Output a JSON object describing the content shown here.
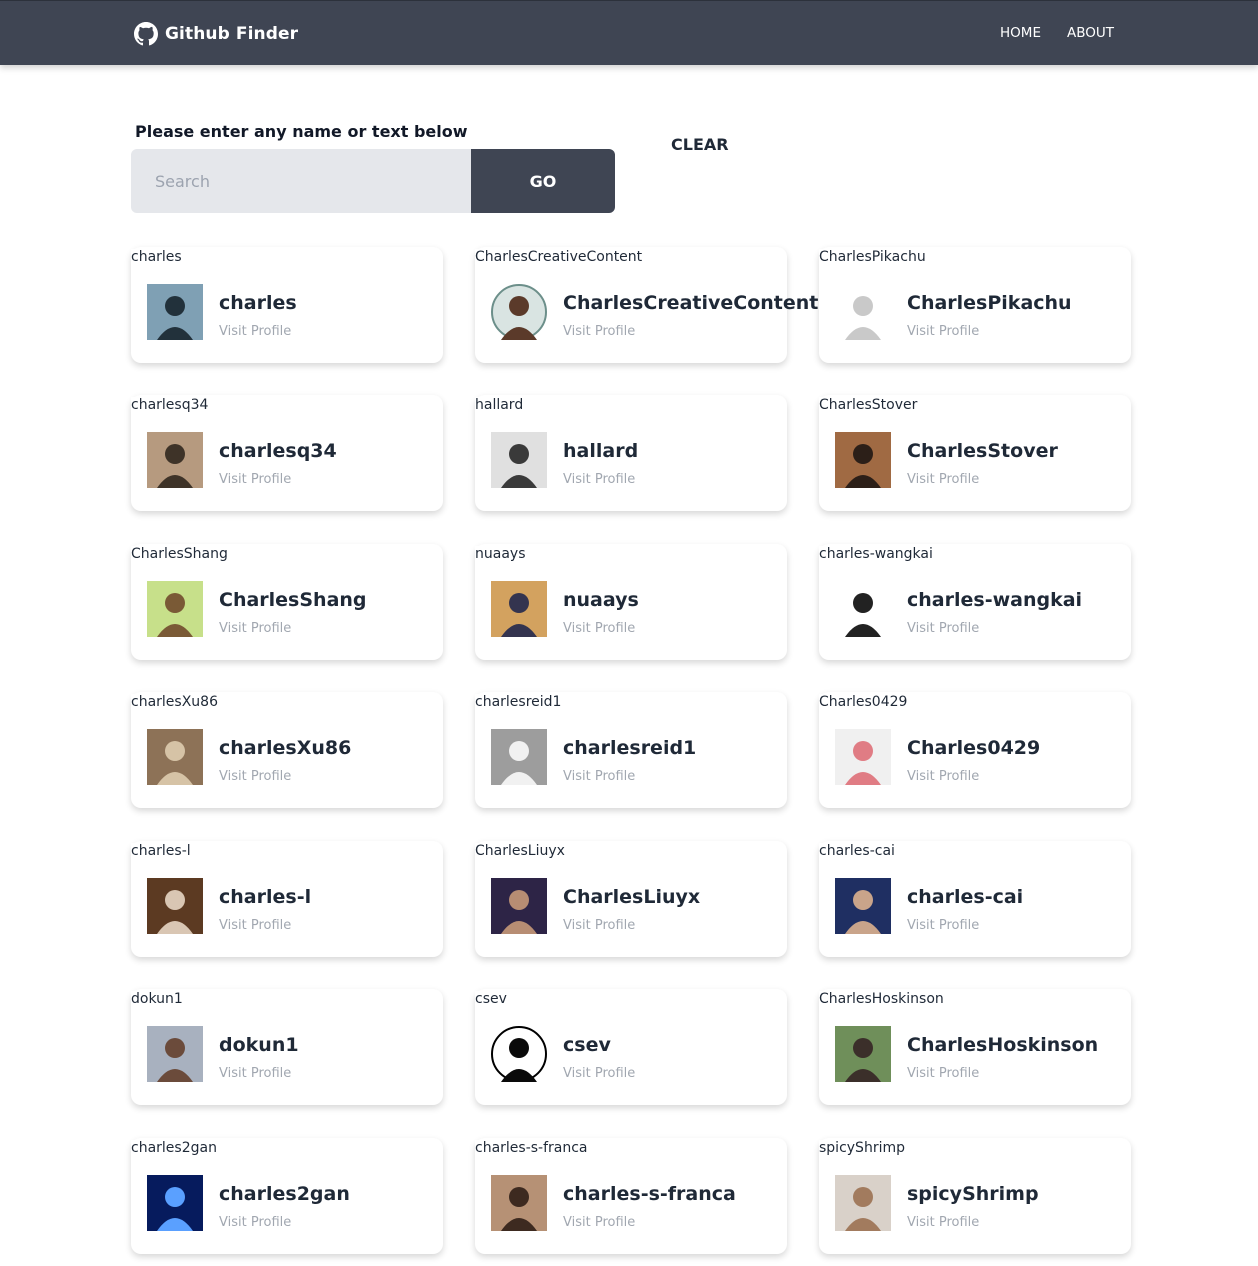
{
  "app": {
    "title": "Github Finder",
    "brand_icon": "github-icon"
  },
  "nav": {
    "home_label": "HOME",
    "about_label": "ABOUT"
  },
  "search": {
    "label": "Please enter any name or text below",
    "placeholder": "Search",
    "value": "",
    "go_label": "GO",
    "clear_label": "CLEAR"
  },
  "colors": {
    "navbar": "#3f4553",
    "go_button": "#3f4553",
    "input_bg": "#e5e7eb",
    "muted_text": "#a1a7b0"
  },
  "users": [
    {
      "login": "charles",
      "visit_label": "Visit Profile",
      "avatar": "silhouette-at-sunset"
    },
    {
      "login": "CharlesCreativeContent",
      "visit_label": "Visit Profile",
      "avatar": "smiling-man-circle"
    },
    {
      "login": "CharlesPikachu",
      "visit_label": "Visit Profile",
      "avatar": "line-sketch"
    },
    {
      "login": "charlesq34",
      "visit_label": "Visit Profile",
      "avatar": "man-with-glasses"
    },
    {
      "login": "hallard",
      "visit_label": "Visit Profile",
      "avatar": "bald-man-bw"
    },
    {
      "login": "CharlesStover",
      "visit_label": "Visit Profile",
      "avatar": "man-in-suit"
    },
    {
      "login": "CharlesShang",
      "visit_label": "Visit Profile",
      "avatar": "cartoon-character"
    },
    {
      "login": "nuaays",
      "visit_label": "Visit Profile",
      "avatar": "anime-warrior"
    },
    {
      "login": "charles-wangkai",
      "visit_label": "Visit Profile",
      "avatar": "white-robot-cartoon"
    },
    {
      "login": "charlesXu86",
      "visit_label": "Visit Profile",
      "avatar": "monkey-photo"
    },
    {
      "login": "charlesreid1",
      "visit_label": "Visit Profile",
      "avatar": "astronaut-bw"
    },
    {
      "login": "Charles0429",
      "visit_label": "Visit Profile",
      "avatar": "pink-identicon"
    },
    {
      "login": "charles-l",
      "visit_label": "Visit Profile",
      "avatar": "painted-face"
    },
    {
      "login": "CharlesLiuyx",
      "visit_label": "Visit Profile",
      "avatar": "young-man-night"
    },
    {
      "login": "charles-cai",
      "visit_label": "Visit Profile",
      "avatar": "man-with-glasses-blue"
    },
    {
      "login": "dokun1",
      "visit_label": "Visit Profile",
      "avatar": "bearded-man"
    },
    {
      "login": "csev",
      "visit_label": "Visit Profile",
      "avatar": "fedora-circle"
    },
    {
      "login": "CharlesHoskinson",
      "visit_label": "Visit Profile",
      "avatar": "man-with-bull"
    },
    {
      "login": "charles2gan",
      "visit_label": "Visit Profile",
      "avatar": "blue-spiral"
    },
    {
      "login": "charles-s-franca",
      "visit_label": "Visit Profile",
      "avatar": "two-people"
    },
    {
      "login": "spicyShrimp",
      "visit_label": "Visit Profile",
      "avatar": "woman-portrait"
    }
  ]
}
